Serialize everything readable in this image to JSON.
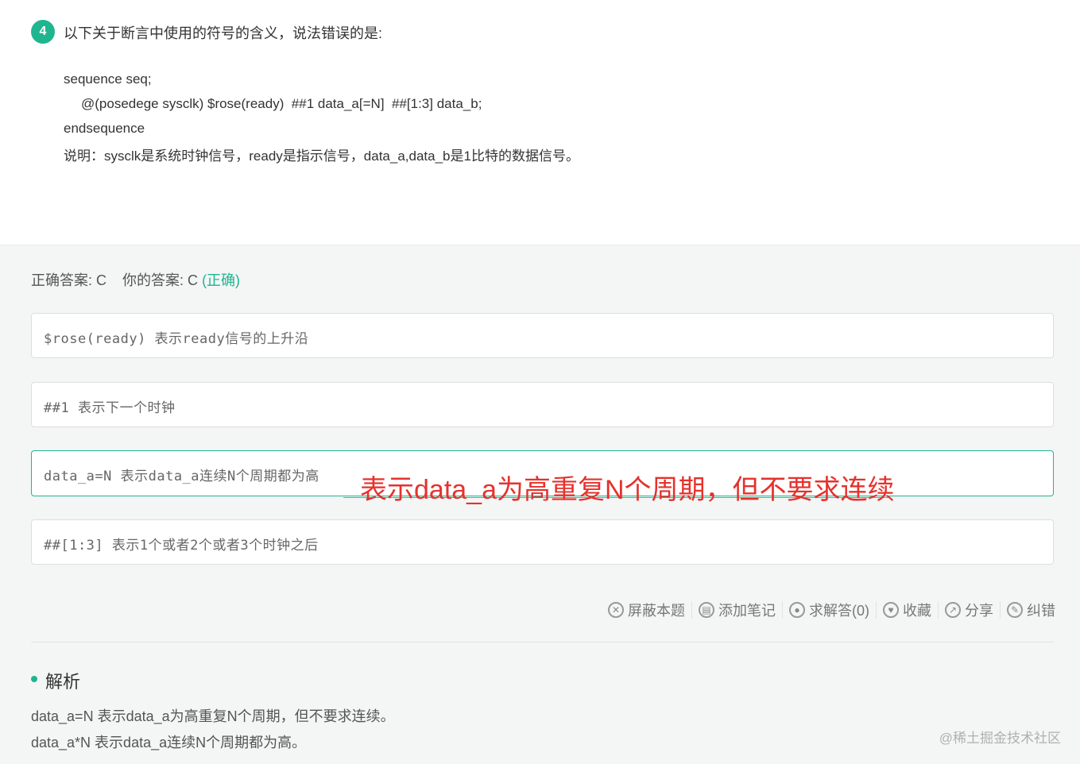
{
  "question": {
    "number": "4",
    "title": "以下关于断言中使用的符号的含义，说法错误的是:",
    "code": [
      "sequence seq;",
      "@(posedege sysclk) $rose(ready)  ##1 data_a[=N]  ##[1:3] data_b;",
      "endsequence",
      "说明：sysclk是系统时钟信号，ready是指示信号，data_a,data_b是1比特的数据信号。"
    ]
  },
  "answer": {
    "correct_label": "正确答案: C",
    "yours_label": "你的答案: C",
    "status": "(正确)"
  },
  "options": [
    {
      "text": "$rose(ready) 表示ready信号的上升沿"
    },
    {
      "text": "##1 表示下一个时钟"
    },
    {
      "text": "data_a=N 表示data_a连续N个周期都为高"
    },
    {
      "text": "##[1:3] 表示1个或者2个或者3个时钟之后"
    }
  ],
  "annotation": "表示data_a为高重复N个周期，但不要求连续",
  "actions": {
    "hide": "屏蔽本题",
    "note": "添加笔记",
    "ask": "求解答(0)",
    "favorite": "收藏",
    "share": "分享",
    "report": "纠错"
  },
  "analysis": {
    "title": "解析",
    "lines": [
      "data_a=N 表示data_a为高重复N个周期，但不要求连续。",
      "data_a*N 表示data_a连续N个周期都为高。"
    ]
  },
  "watermark": "@稀土掘金技术社区",
  "colors": {
    "accent": "#1fb58f",
    "annotation": "#e5322d"
  }
}
